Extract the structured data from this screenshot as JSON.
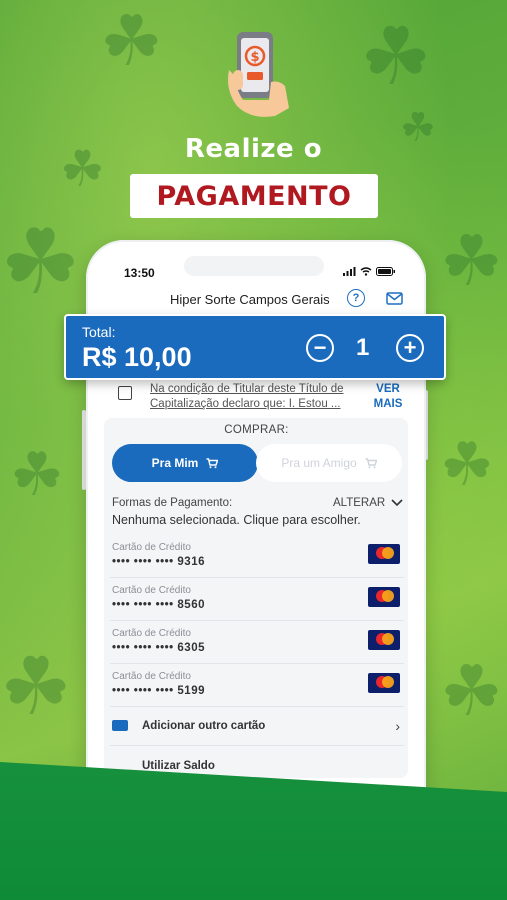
{
  "headline": "Realize o",
  "banner": "PAGAMENTO",
  "status": {
    "time": "13:50"
  },
  "app": {
    "title": "Hiper Sorte Campos Gerais",
    "help": "?"
  },
  "total": {
    "label": "Total:",
    "value": "R$ 10,00",
    "quantity": "1",
    "minus": "−",
    "plus": "+"
  },
  "terms": {
    "text": "Na condição de Titular deste Título de Capitalização declaro que: I. Estou ...",
    "more": "VER MAIS"
  },
  "comprar": {
    "label": "COMPRAR:",
    "tabs": [
      {
        "label": "Pra Mim",
        "icon": "cart-icon",
        "active": true
      },
      {
        "label": "Pra um Amigo",
        "icon": "cart-icon",
        "active": false
      }
    ]
  },
  "payment": {
    "label": "Formas de Pagamento:",
    "change": "ALTERAR",
    "status": "Nenhuma selecionada. Clique para escolher.",
    "cards": [
      {
        "type": "Cartão de Crédito",
        "number": "•••• •••• •••• 9316",
        "brand": "mastercard-icon"
      },
      {
        "type": "Cartão de Crédito",
        "number": "•••• •••• •••• 8560",
        "brand": "mastercard-icon"
      },
      {
        "type": "Cartão de Crédito",
        "number": "•••• •••• •••• 6305",
        "brand": "mastercard-icon"
      },
      {
        "type": "Cartão de Crédito",
        "number": "•••• •••• •••• 5199",
        "brand": "mastercard-icon"
      }
    ],
    "add_card": "Adicionar outro cartão",
    "use_balance": "Utilizar Saldo"
  },
  "colors": {
    "primary": "#1a6bbd",
    "banner_text": "#b01920",
    "green": "#58a83a",
    "dark_green": "#0f8a36"
  }
}
